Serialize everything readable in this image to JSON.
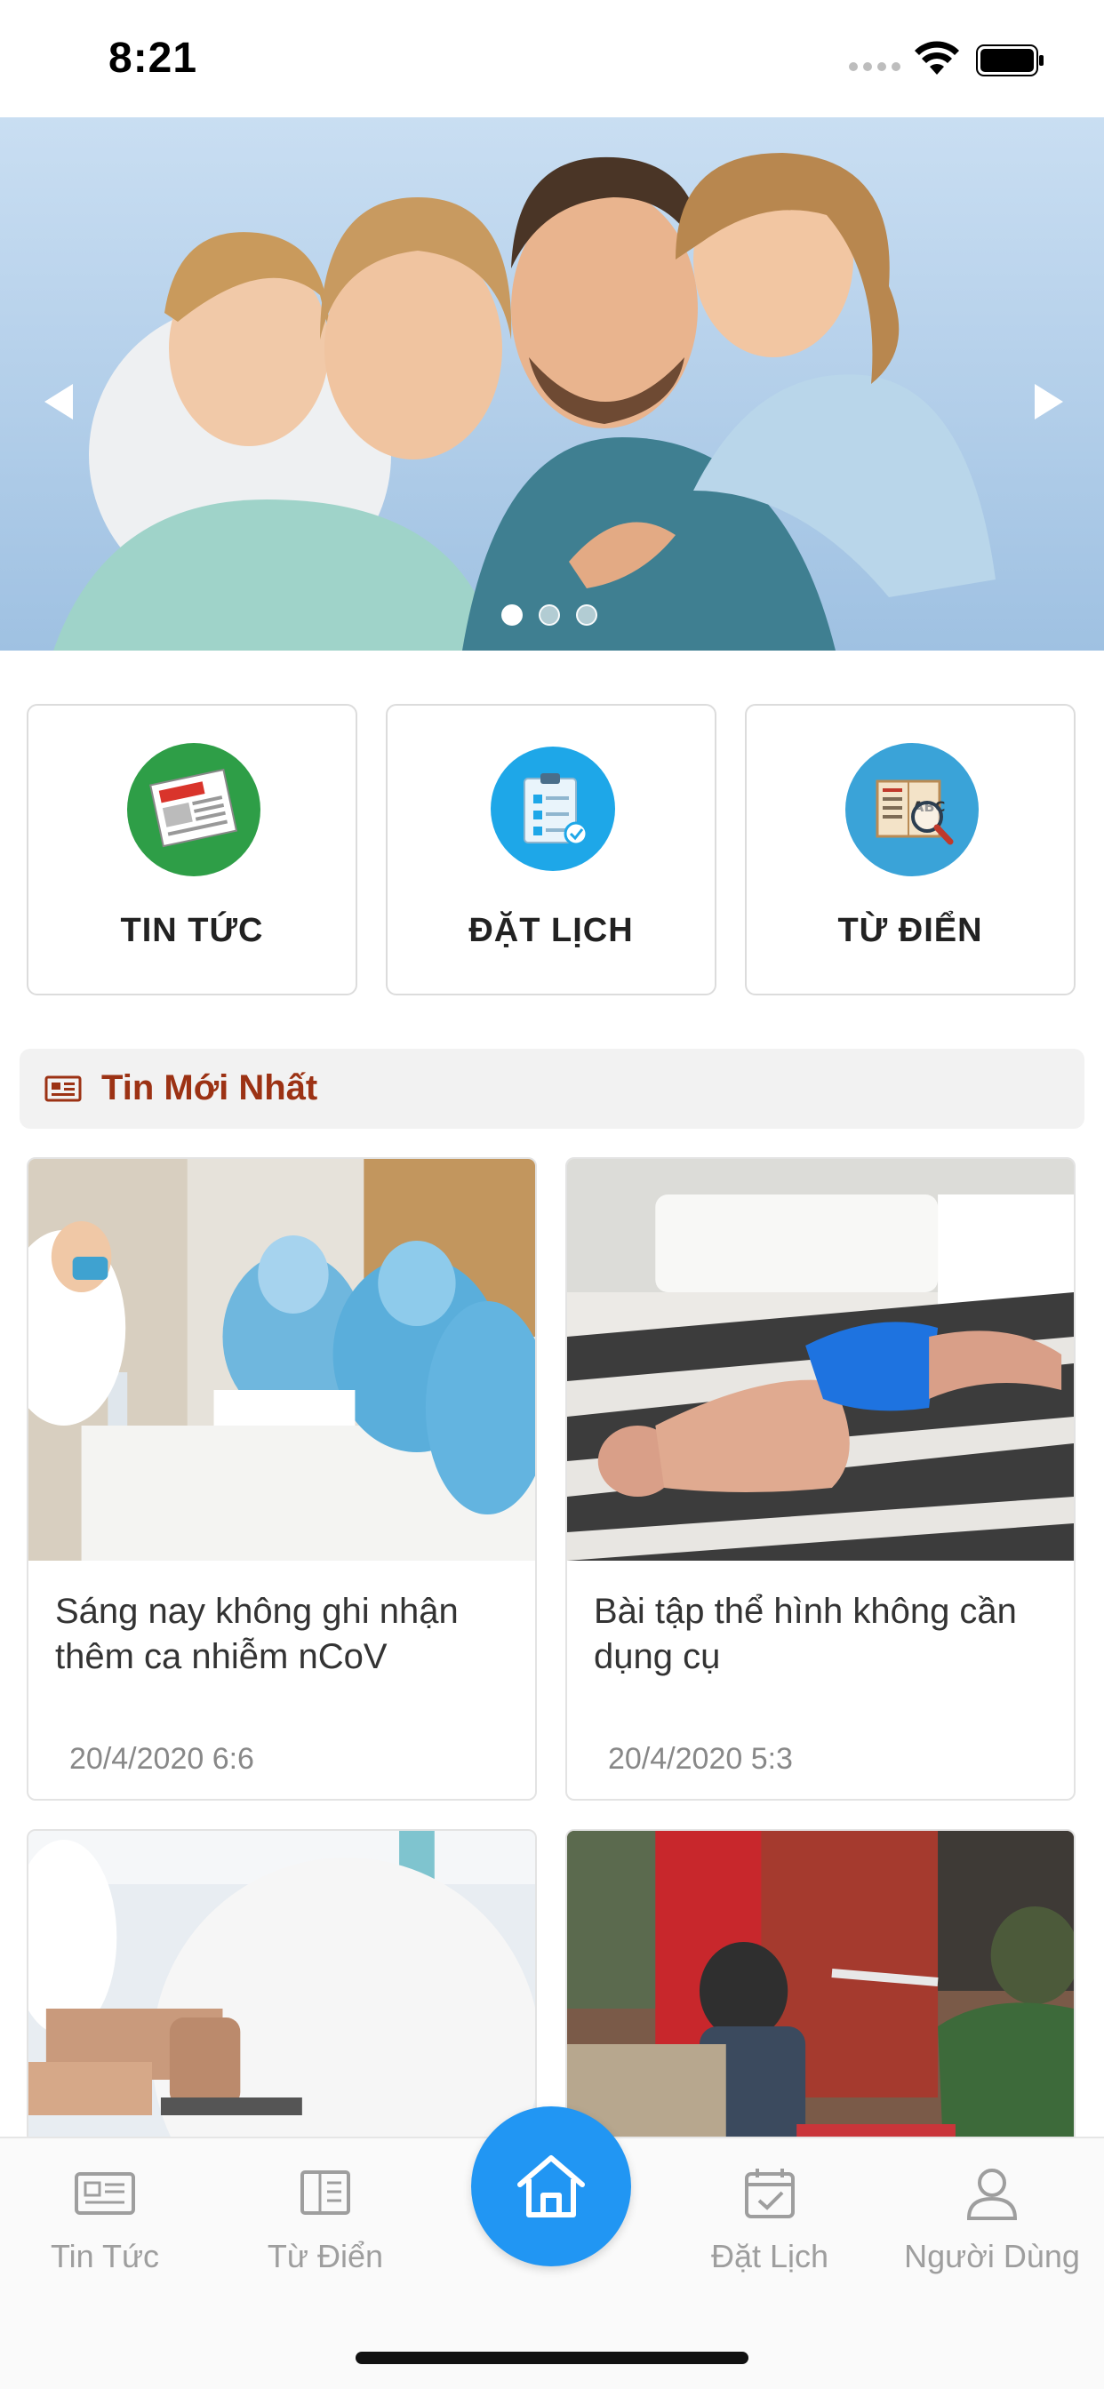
{
  "status_bar": {
    "time": "8:21"
  },
  "banner": {
    "slides": 3,
    "active_slide": 0
  },
  "quick_menu": [
    {
      "label": "TIN TỨC",
      "icon": "newspaper-icon",
      "color": "#2e9e47"
    },
    {
      "label": "ĐẶT LỊCH",
      "icon": "clipboard-icon",
      "color": "#1ea7e8"
    },
    {
      "label": "TỪ ĐIỂN",
      "icon": "dictionary-icon",
      "color": "#3aa3d8"
    }
  ],
  "section": {
    "title": "Tin Mới Nhất",
    "icon": "news-list-icon",
    "color": "#9c3214"
  },
  "news": [
    {
      "title": "Sáng nay không ghi nhận thêm ca nhiễm nCoV",
      "date": "20/4/2020 6:6"
    },
    {
      "title": "Bài tập thể hình không cần dụng cụ",
      "date": "20/4/2020 5:3"
    },
    {
      "title": "",
      "date": ""
    },
    {
      "title": "",
      "date": ""
    }
  ],
  "tab_bar": {
    "items": [
      {
        "label": "Tin Tức",
        "icon": "newspaper-icon"
      },
      {
        "label": "Từ Điển",
        "icon": "book-icon"
      },
      {
        "label": "",
        "icon": "home-icon"
      },
      {
        "label": "Đặt Lịch",
        "icon": "calendar-check-icon"
      },
      {
        "label": "Người Dùng",
        "icon": "user-icon"
      }
    ],
    "active_color": "#2196f3",
    "inactive_color": "#9e9e9e"
  }
}
